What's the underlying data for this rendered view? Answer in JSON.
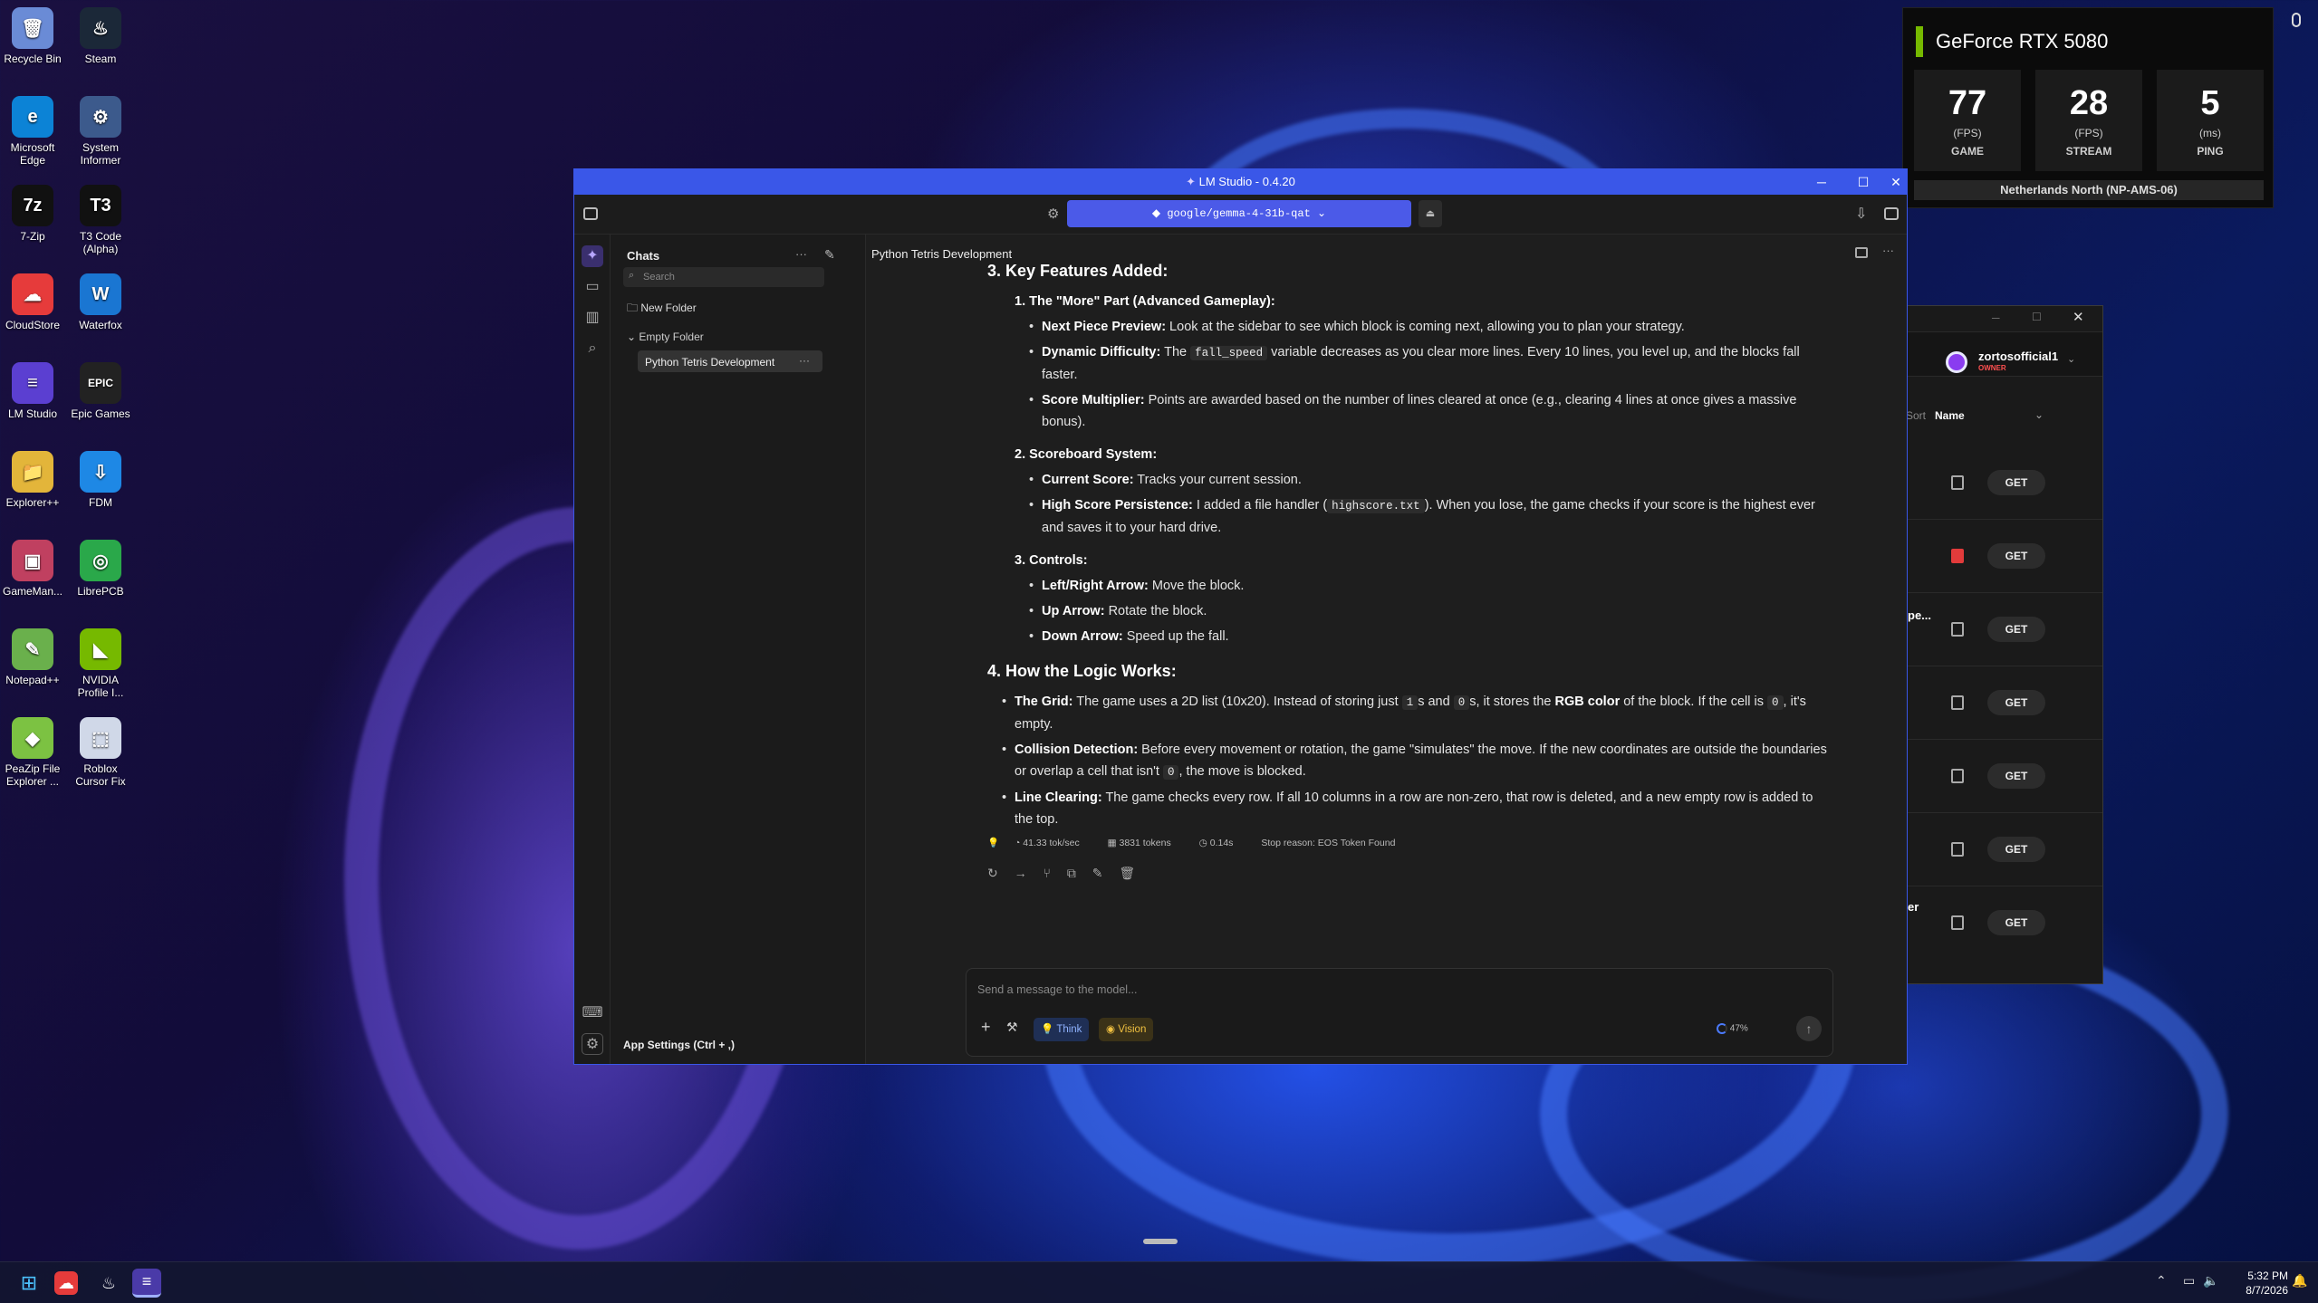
{
  "desktop_icons": [
    {
      "label": "Recycle Bin",
      "icon": "recycle-bin-icon",
      "color": "#6a8bd6",
      "glyph": "🗑"
    },
    {
      "label": "Steam",
      "icon": "steam-icon",
      "color": "#1b2838",
      "glyph": "♨"
    },
    {
      "label": "Microsoft Edge",
      "icon": "edge-icon",
      "color": "#0c83d6",
      "glyph": "e"
    },
    {
      "label": "System Informer",
      "icon": "system-informer-icon",
      "color": "#3c5a8c",
      "glyph": "⚙"
    },
    {
      "label": "7-Zip",
      "icon": "7zip-icon",
      "color": "#111111",
      "glyph": "7z"
    },
    {
      "label": "T3 Code (Alpha)",
      "icon": "t3-code-icon",
      "color": "#111111",
      "glyph": "T3"
    },
    {
      "label": "CloudStore",
      "icon": "cloudstore-icon",
      "color": "#e63b3b",
      "glyph": "☁"
    },
    {
      "label": "Waterfox",
      "icon": "waterfox-icon",
      "color": "#1a76d2",
      "glyph": "W"
    },
    {
      "label": "LM Studio",
      "icon": "lm-studio-icon",
      "color": "#5b3fd1",
      "glyph": "≡"
    },
    {
      "label": "Epic Games",
      "icon": "epic-games-icon",
      "color": "#222222",
      "glyph": "EPIC"
    },
    {
      "label": "Explorer++",
      "icon": "explorer-plus-icon",
      "color": "#e3b53a",
      "glyph": "📁"
    },
    {
      "label": "FDM",
      "icon": "fdm-icon",
      "color": "#1e88e5",
      "glyph": "⇩"
    },
    {
      "label": "GameMan...",
      "icon": "gamemanager-icon",
      "color": "#c04060",
      "glyph": "▣"
    },
    {
      "label": "LibrePCB",
      "icon": "librepcb-icon",
      "color": "#2aa84a",
      "glyph": "◎"
    },
    {
      "label": "Notepad++",
      "icon": "notepad-plus-icon",
      "color": "#6ab04c",
      "glyph": "✎"
    },
    {
      "label": "NVIDIA Profile I...",
      "icon": "nvidia-profile-icon",
      "color": "#76b900",
      "glyph": "◣"
    },
    {
      "label": "PeaZip File Explorer ...",
      "icon": "peazip-icon",
      "color": "#7cc242",
      "glyph": "◆"
    },
    {
      "label": "Roblox Cursor Fix",
      "icon": "roblox-cursor-icon",
      "color": "#d0d8e8",
      "glyph": "⬚"
    }
  ],
  "geforce": {
    "title": "GeForce RTX 5080",
    "accent": "#76b900",
    "metrics": [
      {
        "value": "77",
        "unit": "(FPS)",
        "label": "GAME"
      },
      {
        "value": "28",
        "unit": "(FPS)",
        "label": "STREAM"
      },
      {
        "value": "5",
        "unit": "(ms)",
        "label": "PING"
      }
    ],
    "server": "Netherlands North (NP-AMS-06)"
  },
  "bg_window": {
    "user": "zortosofficial1",
    "role": "OWNER",
    "sort_label": "Sort",
    "sort_value": "Name",
    "get_label": "GET",
    "partial_texts": [
      "pe...",
      "er"
    ]
  },
  "lm": {
    "title": "LM Studio - 0.4.20",
    "model": "google/gemma-4-31b-qat",
    "sidebar": {
      "header": "Chats",
      "search_placeholder": "Search",
      "new_folder": "New Folder",
      "folder": "Empty Folder",
      "chat_item": "Python Tetris Development",
      "settings": "App Settings (Ctrl + ,)"
    },
    "chat_title": "Python Tetris Development",
    "section3_heading": "3. Key Features Added:",
    "s3_1_title": "1. The \"More\" Part (Advanced Gameplay):",
    "s3_1_a_bold": "Next Piece Preview:",
    "s3_1_a_text": " Look at the sidebar to see which block is coming next, allowing you to plan your strategy.",
    "s3_1_b_bold": "Dynamic Difficulty:",
    "s3_1_b_pre": " The ",
    "s3_1_b_code": "fall_speed",
    "s3_1_b_post": " variable decreases as you clear more lines. Every 10 lines, you level up, and the blocks fall faster.",
    "s3_1_c_bold": "Score Multiplier:",
    "s3_1_c_text": " Points are awarded based on the number of lines cleared at once (e.g., clearing 4 lines at once gives a massive bonus).",
    "s3_2_title": "2. Scoreboard System:",
    "s3_2_a_bold": "Current Score:",
    "s3_2_a_text": " Tracks your current session.",
    "s3_2_b_bold": "High Score Persistence:",
    "s3_2_b_pre": " I added a file handler (",
    "s3_2_b_code": "highscore.txt",
    "s3_2_b_post": "). When you lose, the game checks if your score is the highest ever and saves it to your hard drive.",
    "s3_3_title": "3. Controls:",
    "s3_3_a_bold": "Left/Right Arrow:",
    "s3_3_a_text": " Move the block.",
    "s3_3_b_bold": "Up Arrow:",
    "s3_3_b_text": " Rotate the block.",
    "s3_3_c_bold": "Down Arrow:",
    "s3_3_c_text": " Speed up the fall.",
    "section4_heading": "4. How the Logic Works:",
    "s4_a_bold": "The Grid:",
    "s4_a_1": " The game uses a 2D list (10x20). Instead of storing just ",
    "s4_a_code1": "1",
    "s4_a_2": "s and ",
    "s4_a_code2": "0",
    "s4_a_3": "s, it stores the ",
    "s4_a_bold2": "RGB color",
    "s4_a_4": " of the block. If the cell is ",
    "s4_a_code3": "0",
    "s4_a_5": ", it's empty.",
    "s4_b_bold": "Collision Detection:",
    "s4_b_1": " Before every movement or rotation, the game \"simulates\" the move. If the new coordinates are outside the boundaries or overlap a cell that isn't ",
    "s4_b_code": "0",
    "s4_b_2": ", the move is blocked.",
    "s4_c_bold": "Line Clearing:",
    "s4_c_text": " The game checks every row. If all 10 columns in a row are non-zero, that row is deleted, and a new empty row is added to the top.",
    "stats": {
      "speed": "41.33 tok/sec",
      "tokens": "3831 tokens",
      "time": "0.14s",
      "stop": "Stop reason: EOS Token Found"
    },
    "composer": {
      "placeholder": "Send a message to the model...",
      "think": "Think",
      "vision": "Vision",
      "context": "47%"
    }
  },
  "taskbar": {
    "time": "5:32 PM",
    "date": "8/7/2026"
  }
}
